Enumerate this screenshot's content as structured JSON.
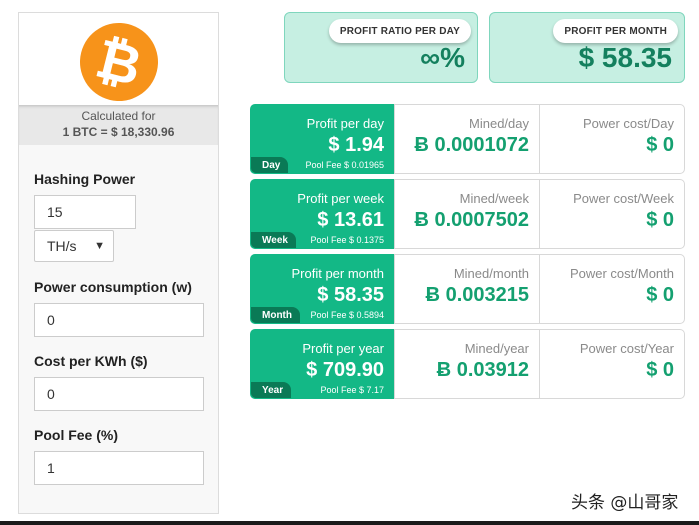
{
  "sidebar": {
    "logo_glyph": "₿",
    "logo_color": "#f7931a",
    "calc_label": "Calculated for",
    "rate": "1 BTC = $ 18,330.96",
    "hashing_power_label": "Hashing Power",
    "hashing_power_value": "15",
    "unit_value": "TH/s",
    "power_label": "Power consumption (w)",
    "power_value": "0",
    "cost_label": "Cost per KWh ($)",
    "cost_value": "0",
    "fee_label": "Pool Fee (%)",
    "fee_value": "1"
  },
  "ratio": {
    "day_label": "PROFIT RATIO PER DAY",
    "day_value": "∞%",
    "month_label": "PROFIT PER MONTH",
    "month_value": "$ 58.35"
  },
  "rows": [
    {
      "profit_label": "Profit per day",
      "profit": "$ 1.94",
      "badge": "Day",
      "fee": "Pool Fee $ 0.01965",
      "mined_label": "Mined/day",
      "mined": "Ƀ 0.0001072",
      "power_label": "Power cost/Day",
      "power": "$ 0"
    },
    {
      "profit_label": "Profit per week",
      "profit": "$ 13.61",
      "badge": "Week",
      "fee": "Pool Fee $ 0.1375",
      "mined_label": "Mined/week",
      "mined": "Ƀ 0.0007502",
      "power_label": "Power cost/Week",
      "power": "$ 0"
    },
    {
      "profit_label": "Profit per month",
      "profit": "$ 58.35",
      "badge": "Month",
      "fee": "Pool Fee $ 0.5894",
      "mined_label": "Mined/month",
      "mined": "Ƀ 0.003215",
      "power_label": "Power cost/Month",
      "power": "$ 0"
    },
    {
      "profit_label": "Profit per year",
      "profit": "$ 709.90",
      "badge": "Year",
      "fee": "Pool Fee $ 7.17",
      "mined_label": "Mined/year",
      "mined": "Ƀ 0.03912",
      "power_label": "Power cost/Year",
      "power": "$ 0"
    }
  ],
  "colors": {
    "accent": "#13b886",
    "accent_dark": "#0a7a56",
    "value_green": "#14a070",
    "ratio_bg": "#c6efe2"
  },
  "watermark": "头条 @山哥家"
}
